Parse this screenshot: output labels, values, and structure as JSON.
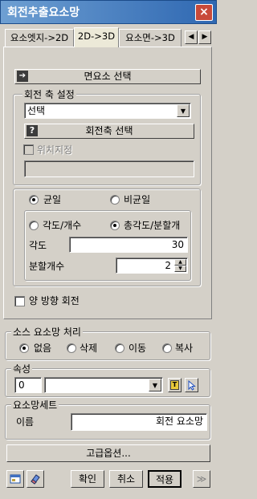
{
  "window": {
    "title": "회전추출요소망",
    "close_symbol": "×"
  },
  "tabs": [
    {
      "label": "요소엣지->2D"
    },
    {
      "label": "2D->3D"
    },
    {
      "label": "요소면->3D"
    }
  ],
  "tab_scroll": {
    "left": "◀",
    "right": "▶"
  },
  "face_select_button": {
    "label": "면요소 선택"
  },
  "axis_group": {
    "title": "회전 축 설정",
    "select_value": "선택",
    "axis_select_button": "회전축 선택",
    "position_checkbox": "위치지정",
    "position_field_value": ""
  },
  "distribution": {
    "uniform": "균일",
    "nonuniform": "비균일",
    "selected": "uniform",
    "angle_per_count": "각도/개수",
    "total_angle_division": "총각도/분할개",
    "mode_selected": "total",
    "angle_label": "각도",
    "angle_value": "30",
    "division_label": "분할개수",
    "division_value": "2"
  },
  "both_directions_checkbox": "양 방향 회전",
  "source_mesh": {
    "title": "소스 요소망 처리",
    "options": [
      "없음",
      "삭제",
      "이동",
      "복사"
    ],
    "selected": "없음"
  },
  "attribute": {
    "title": "속성",
    "id_value": "0",
    "select_value": ""
  },
  "mesh_set": {
    "title": "요소망세트",
    "name_label": "이름",
    "name_value": "회전 요소망"
  },
  "advanced_button": "고급옵션...",
  "footer": {
    "ok": "확인",
    "cancel": "취소",
    "apply": "적용",
    "more": "≫"
  }
}
